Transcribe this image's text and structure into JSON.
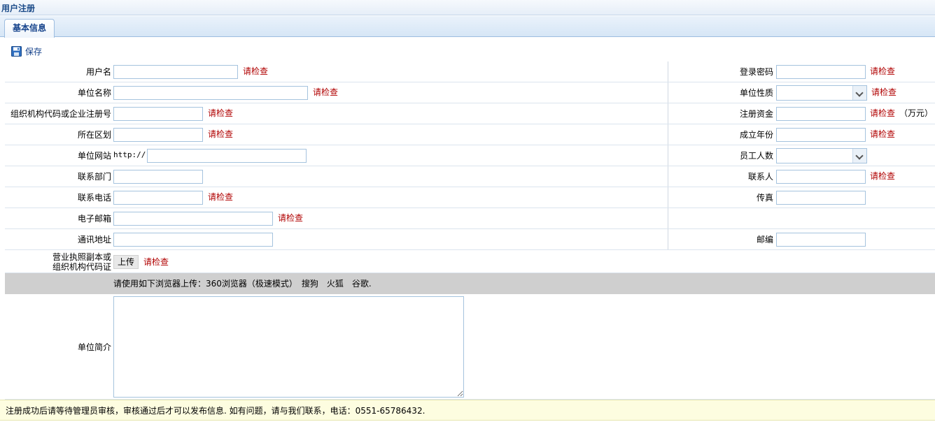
{
  "page": {
    "title": "用户注册"
  },
  "tabs": [
    {
      "label": "基本信息"
    }
  ],
  "toolbar": {
    "save_label": "保存"
  },
  "warn_text": "请检查",
  "fields": {
    "username_label": "用户名",
    "password_label": "登录密码",
    "company_name_label": "单位名称",
    "company_type_label": "单位性质",
    "org_code_label": "组织机构代码或企业注册号",
    "capital_label": "注册资金",
    "capital_unit": "（万元）",
    "district_label": "所在区划",
    "founded_year_label": "成立年份",
    "website_label": "单位网站",
    "website_prefix": "http://",
    "employees_label": "员工人数",
    "department_label": "联系部门",
    "contact_label": "联系人",
    "phone_label": "联系电话",
    "fax_label": "传真",
    "email_label": "电子邮箱",
    "address_label": "通讯地址",
    "zipcode_label": "邮编",
    "license_label_line1": "营业执照副本或",
    "license_label_line2": "组织机构代码证",
    "upload_label": "上传",
    "browser_hint": "请使用如下浏览器上传：360浏览器（极速模式）　搜狗　火狐　谷歌.",
    "description_label": "单位简介"
  },
  "notice": "注册成功后请等待管理员审核，审核通过后才可以发布信息. 如有问题，请与我们联系，电话：0551-65786432.",
  "colors": {
    "accent": "#15428b",
    "warn": "#b00000",
    "notice_bg": "#fdfde0"
  }
}
